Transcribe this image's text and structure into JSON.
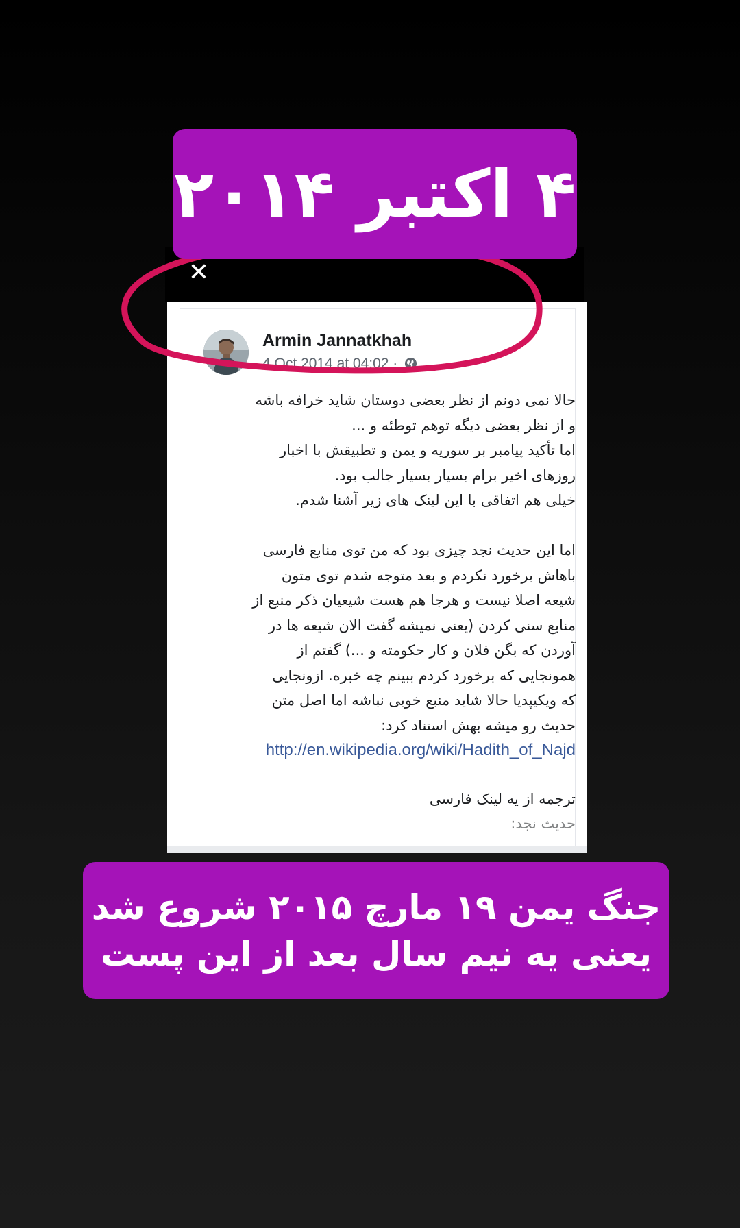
{
  "overlay": {
    "date_label": "۴ اکتبر ۲۰۱۴",
    "caption_line1": "جنگ یمن ۱۹ مارچ ۲۰۱۵ شروع شد",
    "caption_line2": "یعنی یه نیم سال بعد از این پست",
    "label_color": "#a513b8",
    "ellipse_color": "#d4145a"
  },
  "viewer": {
    "close_icon": "close-icon",
    "close_glyph": "✕"
  },
  "post": {
    "author": "Armin Jannatkhah",
    "timestamp": "4 Oct 2014 at 04:02 ·",
    "privacy_icon": "globe-icon",
    "paragraph1": [
      "حالا نمی دونم از نظر بعضی دوستان شاید خرافه باشه",
      "و از نظر بعضی دیگه توهم توطئه و ...",
      "اما تأکید پیامبر بر سوریه و یمن و تطبیقش با اخبار",
      "روزهای اخیر برام بسیار بسیار جالب بود.",
      "خیلی هم اتفاقی با این لینک های زیر آشنا شدم."
    ],
    "paragraph2": [
      "اما این حدیث نجد چیزی بود که من توی منابع فارسی",
      "باهاش برخورد نکردم و بعد متوجه شدم توی متون",
      "شیعه اصلا نیست و هرجا هم هست شیعیان ذکر منبع از",
      "منابع سنی کردن (یعنی نمیشه گفت الان شیعه ها در",
      "آوردن که بگن فلان و کار حکومته و ...) گفتم از",
      "همونجایی که برخورد کردم ببینم چه خبره. ازونجایی",
      "که ویکیپدیا حالا شاید منبع خوبی نباشه اما اصل متن",
      "حدیث رو میشه بهش استناد کرد:"
    ],
    "link": "http://en.wikipedia.org/wiki/Hadith_of_Najd",
    "paragraph3": [
      "ترجمه از یه لینک فارسی",
      "حدیث نجد:"
    ]
  }
}
